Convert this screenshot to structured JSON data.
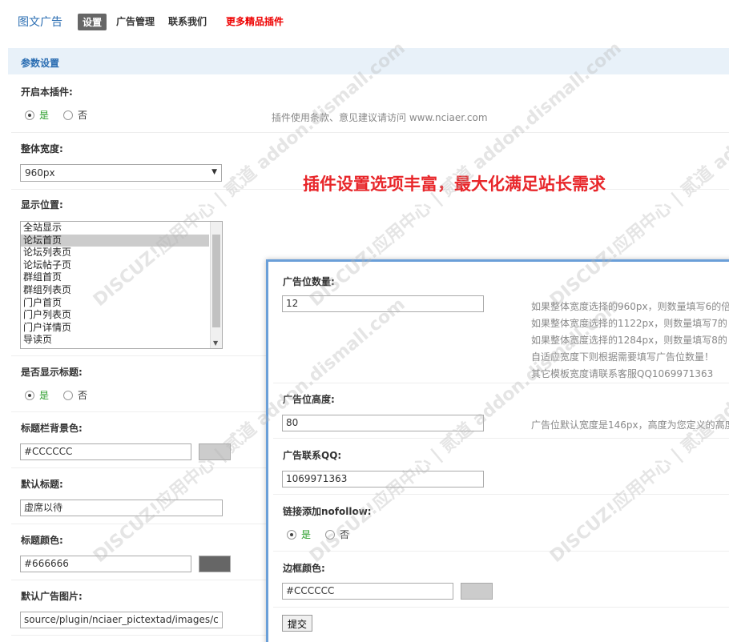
{
  "nav": {
    "brand": "图文广告",
    "tabs": [
      {
        "label": "设置",
        "active": true
      },
      {
        "label": "广告管理"
      },
      {
        "label": "联系我们"
      },
      {
        "label": "更多精品插件",
        "color": "#e00000"
      }
    ]
  },
  "section_title": "参数设置",
  "settings": {
    "enable": {
      "label": "开启本插件:",
      "yes": "是",
      "no": "否",
      "selected": "yes",
      "hint": "插件使用条款、意见建议请访问 www.nciaer.com"
    },
    "width": {
      "label": "整体宽度:",
      "value": "960px"
    },
    "position": {
      "label": "显示位置:",
      "options": [
        "全站显示",
        "论坛首页",
        "论坛列表页",
        "论坛帖子页",
        "群组首页",
        "群组列表页",
        "门户首页",
        "门户列表页",
        "门户详情页",
        "导读页"
      ],
      "selected": "论坛首页"
    },
    "show_title": {
      "label": "是否显示标题:",
      "yes": "是",
      "no": "否",
      "selected": "yes"
    },
    "title_bg": {
      "label": "标题栏背景色:",
      "value": "#CCCCCC",
      "swatch": "#cccccc"
    },
    "default_title": {
      "label": "默认标题:",
      "value": "虚席以待"
    },
    "title_color": {
      "label": "标题颜色:",
      "value": "#666666",
      "swatch": "#666666"
    },
    "default_image": {
      "label": "默认广告图片:",
      "value": "source/plugin/nciaer_pictextad/images/c"
    }
  },
  "promo_text": "插件设置选项丰富，最大化满足站长需求",
  "panel": {
    "count": {
      "label": "广告位数量:",
      "value": "12",
      "hints": [
        "如果整体宽度选择的960px，则数量填写6的倍",
        "如果整体宽度选择的1122px，则数量填写7的",
        "如果整体宽度选择的1284px，则数量填写8的",
        "自适应宽度下则根据需要填写广告位数量！",
        "其它模板宽度请联系客服QQ1069971363"
      ]
    },
    "height": {
      "label": "广告位高度:",
      "value": "80",
      "hint": "广告位默认宽度是146px，高度为您定义的高度"
    },
    "qq": {
      "label": "广告联系QQ:",
      "value": "1069971363"
    },
    "nofollow": {
      "label": "链接添加nofollow:",
      "yes": "是",
      "no": "否",
      "selected": "yes"
    },
    "border_color": {
      "label": "边框颜色:",
      "value": "#CCCCCC",
      "swatch": "#cccccc"
    },
    "submit": "提交"
  },
  "watermark": "DISCUZ!应用中心 | 贰道 addon.dismall.com"
}
